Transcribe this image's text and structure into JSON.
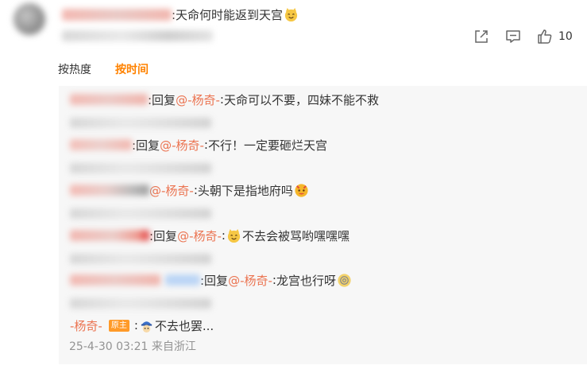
{
  "top_comment": {
    "text": ":天命何时能返到天宫",
    "icons": {
      "emoji": "cat-face-emoji"
    }
  },
  "actions": {
    "share_icon": "share-icon",
    "comment_icon": "comment-icon",
    "like_icon": "thumbs-up-icon",
    "like_count": "10"
  },
  "sort": {
    "hot_label": "按热度",
    "time_label": "按时间",
    "active": "time",
    "active_color": "#ff8200"
  },
  "replies": [
    {
      "prefix": ":回复",
      "mention": "@-杨奇-",
      "sep": ":",
      "text": "天命可以不要，四妹不能不救"
    },
    {
      "prefix": ":回复",
      "mention": "@-杨奇-",
      "sep": ":",
      "text": "不行！一定要砸烂天宫"
    },
    {
      "prefix": "",
      "mention": "@-杨奇-",
      "sep": ":",
      "text": "头朝下是指地府吗",
      "emoji": "sticker-emoji"
    },
    {
      "prefix": ":回复",
      "mention": "@-杨奇-",
      "sep": ":",
      "text": "不去会被骂哟嘿嘿嘿",
      "emoji": "cat-face-emoji"
    },
    {
      "prefix": ":回复",
      "mention": "@-杨奇-",
      "sep": ":",
      "text": "龙宫也行呀",
      "emoji": "dizzy-face-emoji"
    },
    {
      "author": "-杨奇-",
      "badge": "原主",
      "sep": ":",
      "text": "不去也罢...",
      "emoji": "blue-hat-sticker-emoji",
      "time": "25-4-30 03:21 来自浙江"
    }
  ],
  "colors": {
    "mention": "#eb7350",
    "badge_bg": "#ff9a28",
    "panel_bg": "#f7f7f7",
    "meta_text": "#939393"
  }
}
